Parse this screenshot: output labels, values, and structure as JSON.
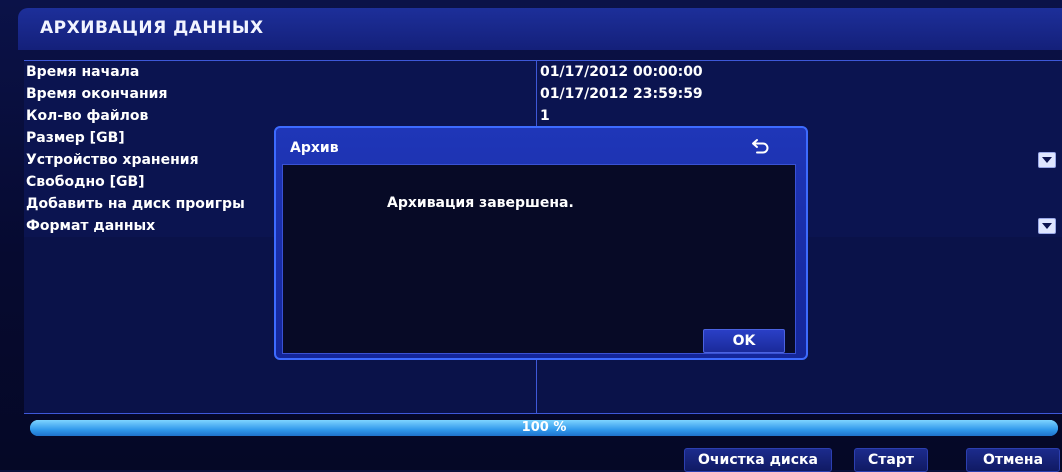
{
  "header": {
    "title": "АРХИВАЦИЯ ДАННЫХ"
  },
  "rows": [
    {
      "label": "Время начала",
      "value": "01/17/2012 00:00:00",
      "has_dropdown": false
    },
    {
      "label": "Время окончания",
      "value": "01/17/2012 23:59:59",
      "has_dropdown": false
    },
    {
      "label": "Кол-во файлов",
      "value": "1",
      "has_dropdown": false
    },
    {
      "label": "Размер [GB]",
      "value": "",
      "has_dropdown": false
    },
    {
      "label": "Устройство хранения",
      "value": "",
      "has_dropdown": true
    },
    {
      "label": "Свободно [GB]",
      "value": "",
      "has_dropdown": false
    },
    {
      "label": "Добавить на диск проигры",
      "value": "",
      "has_dropdown": false
    },
    {
      "label": "Формат данных",
      "value": "",
      "has_dropdown": true
    }
  ],
  "progress": {
    "percent": 100,
    "label": "100 %"
  },
  "buttons": {
    "clear_disk": "Очистка диска",
    "start": "Старт",
    "cancel": "Отмена"
  },
  "dialog": {
    "title": "Архив",
    "message": "Архивация завершена.",
    "ok_label": "OK",
    "close_icon": "back-arrow-icon"
  },
  "colors": {
    "background": "#0a0f3a",
    "grid_line": "#3e58d8",
    "dialog_frame": "#1f36b8",
    "progress_fill": "#2f8fe6"
  }
}
